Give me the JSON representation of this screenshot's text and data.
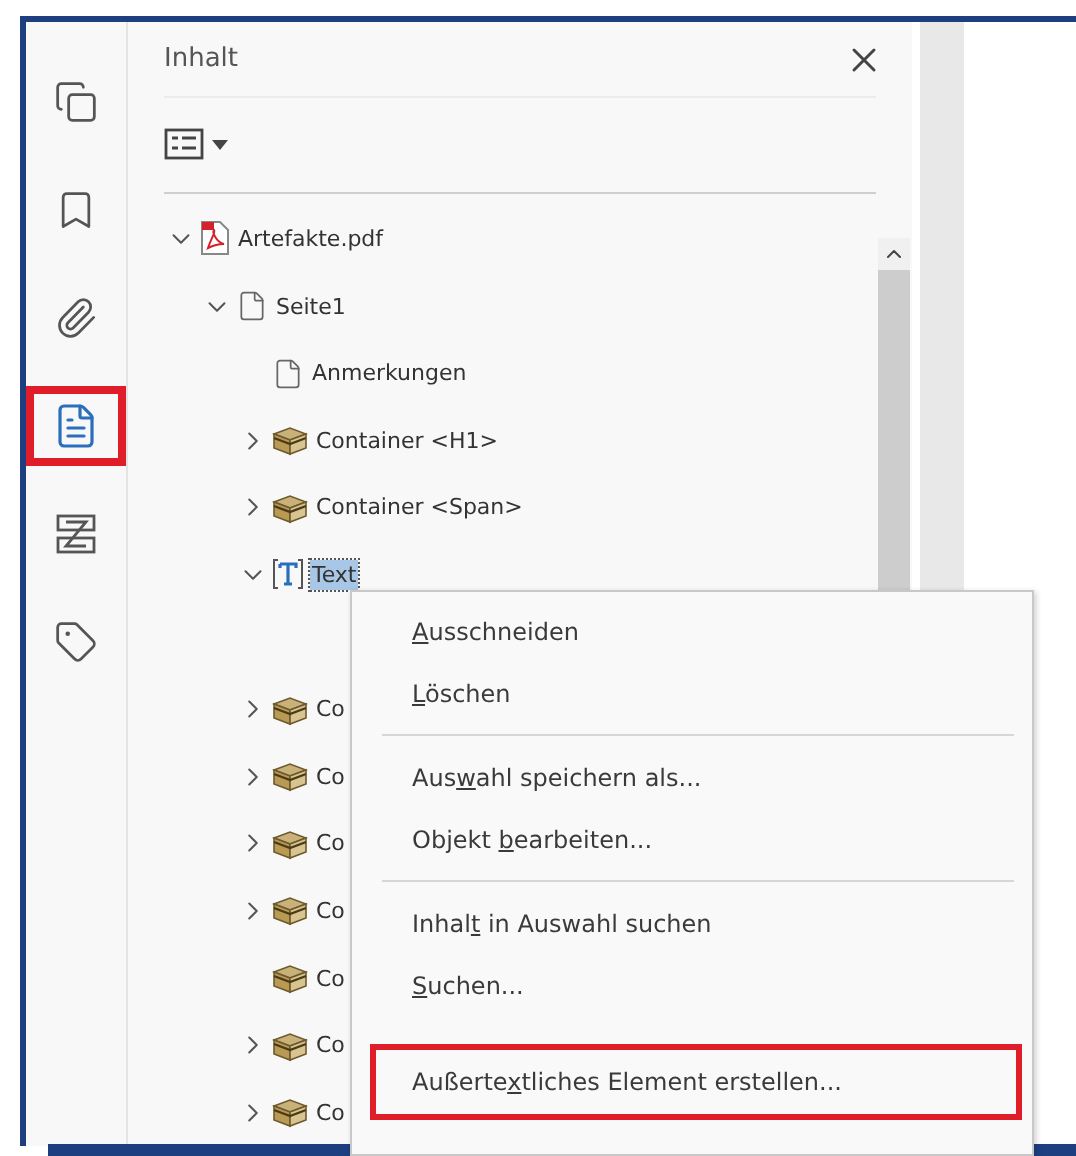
{
  "sidebar": {
    "items": [
      {
        "kind": "pages",
        "selected": false,
        "highlighted": false
      },
      {
        "kind": "bookmarks",
        "selected": false,
        "highlighted": false
      },
      {
        "kind": "attachments",
        "selected": false,
        "highlighted": false
      },
      {
        "kind": "content",
        "selected": true,
        "highlighted": true
      },
      {
        "kind": "order",
        "selected": false,
        "highlighted": false
      },
      {
        "kind": "tags",
        "selected": false,
        "highlighted": false
      }
    ]
  },
  "panel": {
    "title": "Inhalt",
    "tree": [
      {
        "label": "Artefakte.pdf",
        "kind": "pdf",
        "expanded": true,
        "selected": false,
        "children": [
          {
            "label": "Seite1",
            "kind": "page",
            "expanded": true,
            "selected": false,
            "children": [
              {
                "label": "Anmerkungen",
                "kind": "page",
                "selected": false
              },
              {
                "label": "Container <H1>",
                "kind": "container",
                "expanded": false,
                "selected": false
              },
              {
                "label": "Container <Span>",
                "kind": "container",
                "expanded": false,
                "selected": false
              },
              {
                "label": "Text",
                "kind": "text",
                "expanded": true,
                "selected": true
              },
              {
                "label": "Co",
                "kind": "container",
                "expanded": false,
                "selected": false
              },
              {
                "label": "Co",
                "kind": "container",
                "expanded": false,
                "selected": false
              },
              {
                "label": "Co",
                "kind": "container",
                "expanded": false,
                "selected": false
              },
              {
                "label": "Co",
                "kind": "container",
                "expanded": false,
                "selected": false
              },
              {
                "label": "Co",
                "kind": "container",
                "selected": false
              },
              {
                "label": "Co",
                "kind": "container",
                "expanded": false,
                "selected": false
              },
              {
                "label": "Co",
                "kind": "container",
                "expanded": false,
                "selected": false
              }
            ]
          }
        ]
      }
    ]
  },
  "context_menu": {
    "items": [
      {
        "kind": "item",
        "key": "A",
        "after": "usschneiden",
        "highlighted": false
      },
      {
        "kind": "item",
        "key": "L",
        "after": "öschen",
        "highlighted": false
      },
      {
        "kind": "separator"
      },
      {
        "kind": "item",
        "before": "Aus",
        "key": "w",
        "after": "ahl speichern als...",
        "highlighted": false
      },
      {
        "kind": "item",
        "before": "Objekt ",
        "key": "b",
        "after": "earbeiten...",
        "highlighted": false
      },
      {
        "kind": "separator"
      },
      {
        "kind": "item",
        "before": "Inhal",
        "key": "t",
        "after": " in Auswahl suchen",
        "highlighted": false
      },
      {
        "kind": "item",
        "key": "S",
        "after": "uchen...",
        "highlighted": false
      },
      {
        "kind": "separator-gap"
      },
      {
        "kind": "item",
        "before": "Außerte",
        "key": "x",
        "after": "tliches Element erstellen...",
        "highlighted": true
      }
    ]
  }
}
